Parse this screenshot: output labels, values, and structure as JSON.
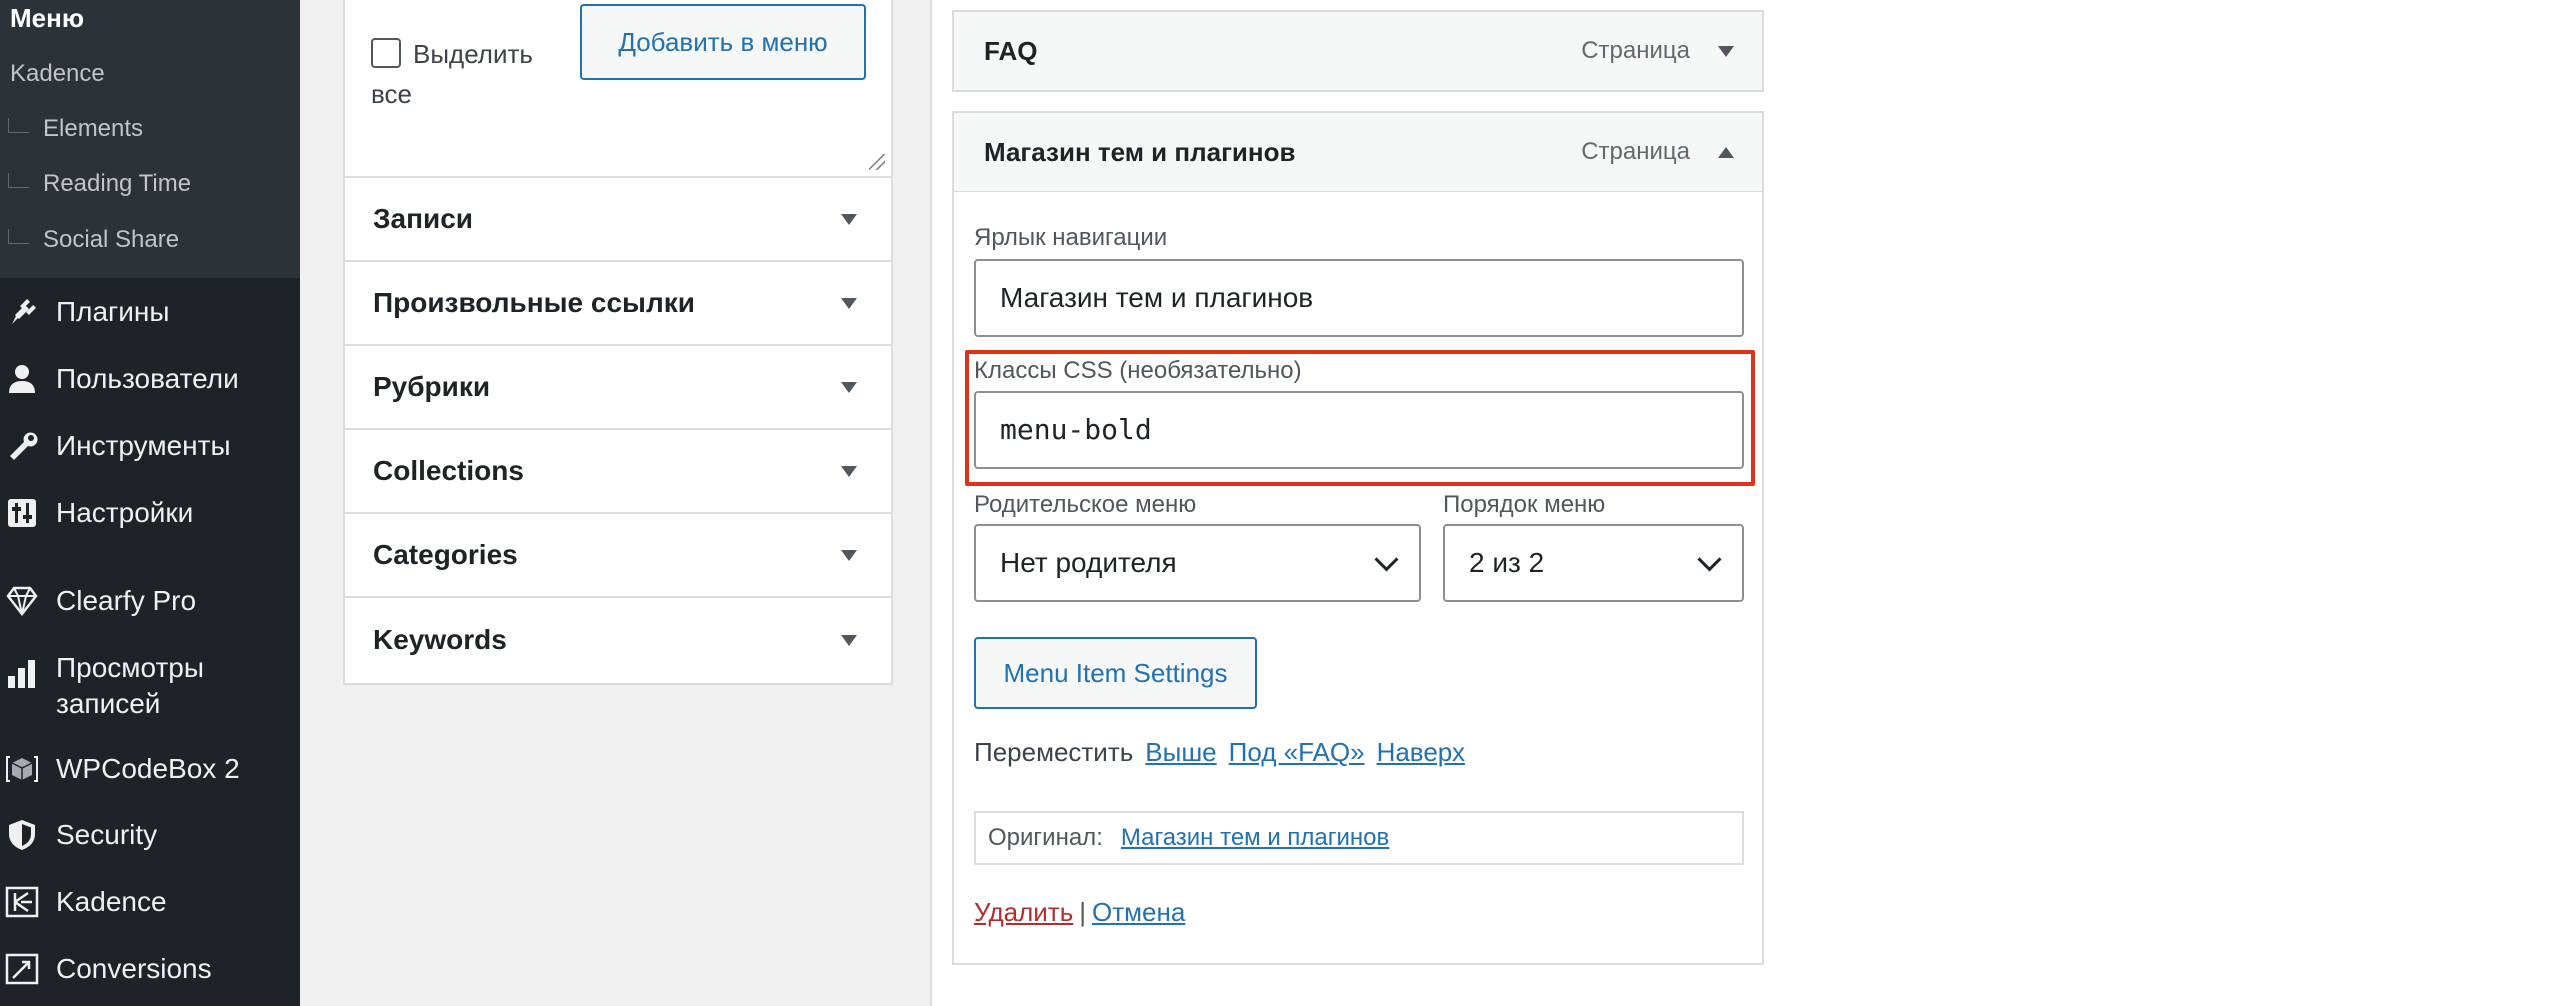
{
  "sidebar": {
    "submenu": {
      "current": "Меню",
      "items": [
        "Kadence",
        "Elements",
        "Reading Time",
        "Social Share"
      ]
    },
    "items": [
      {
        "label": "Плагины",
        "icon": "plugin-icon"
      },
      {
        "label": "Пользователи",
        "icon": "user-icon"
      },
      {
        "label": "Инструменты",
        "icon": "wrench-icon"
      },
      {
        "label": "Настройки",
        "icon": "settings-sliders-icon"
      },
      {
        "label": "Clearfy Pro",
        "icon": "diamond-icon"
      },
      {
        "label": "Просмотры записей",
        "icon": "bar-chart-icon"
      },
      {
        "label": "WPCodeBox 2",
        "icon": "code-box-icon"
      },
      {
        "label": "Security",
        "icon": "shield-icon"
      },
      {
        "label": "Kadence",
        "icon": "kadence-icon"
      },
      {
        "label": "Conversions",
        "icon": "conversions-icon"
      }
    ]
  },
  "left_panel": {
    "select_all_label": "Выделить все",
    "add_button": "Добавить в меню",
    "sections": [
      "Записи",
      "Произвольные ссылки",
      "Рубрики",
      "Collections",
      "Categories",
      "Keywords"
    ]
  },
  "menu_items": [
    {
      "title": "FAQ",
      "type": "Страница",
      "expanded": false
    },
    {
      "title": "Магазин тем и плагинов",
      "type": "Страница",
      "expanded": true
    }
  ],
  "item_settings": {
    "nav_label": {
      "label": "Ярлык навигации",
      "value": "Магазин тем и плагинов"
    },
    "css_classes": {
      "label": "Классы CSS (необязательно)",
      "value": "menu-bold"
    },
    "parent_menu": {
      "label": "Родительское меню",
      "value": "Нет родителя"
    },
    "menu_order": {
      "label": "Порядок меню",
      "value": "2 из 2"
    },
    "settings_button": "Menu Item Settings",
    "move": {
      "label": "Переместить",
      "links": [
        "Выше",
        "Под «FAQ»",
        "Наверх"
      ]
    },
    "original": {
      "label": "Оригинал:",
      "link": "Магазин тем и плагинов"
    },
    "actions": {
      "delete": "Удалить",
      "separator": "|",
      "cancel": "Отмена"
    }
  },
  "colors": {
    "sidebar_bg": "#1d2327",
    "submenu_bg": "#2c3338",
    "accent": "#2271b1",
    "highlight": "#e0321b",
    "delete": "#b32d2e"
  }
}
